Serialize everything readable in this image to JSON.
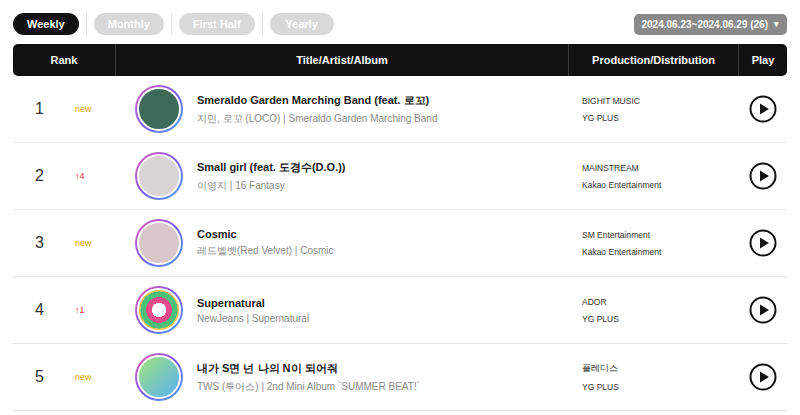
{
  "tabs": [
    {
      "label": "Weekly",
      "selected": true
    },
    {
      "label": "Monthly",
      "selected": false
    },
    {
      "label": "First Half",
      "selected": false
    },
    {
      "label": "Yearly",
      "selected": false
    }
  ],
  "period": {
    "label": "2024.06.23~2024.06.29 (26)",
    "icon": "▾"
  },
  "table": {
    "columns": [
      "Rank",
      "Title/Artist/Album",
      "Production/Distribution",
      "Play"
    ],
    "rows": [
      {
        "rank": "1",
        "change": "new",
        "change_kind": "new",
        "title": "Smeraldo Garden Marching Band (feat. 로꼬)",
        "meta": "지민, 로꼬 (LOCO) | Smeraldo Garden Marching Band",
        "production": "BIGHIT MUSIC",
        "distribution": "YG PLUS"
      },
      {
        "rank": "2",
        "change": "↑4",
        "change_kind": "up",
        "title": "Small girl (feat. 도경수(D.O.))",
        "meta": "이영지 | 16 Fantasy",
        "production": "MAINSTREAM",
        "distribution": "Kakao Entertainment"
      },
      {
        "rank": "3",
        "change": "new",
        "change_kind": "new",
        "title": "Cosmic",
        "meta": "레드벨벳(Red Velvet) | Cosmic",
        "production": "SM Entertainment",
        "distribution": "Kakao Entertainment"
      },
      {
        "rank": "4",
        "change": "↑1",
        "change_kind": "up",
        "title": "Supernatural",
        "meta": "NewJeans | Supernatural",
        "production": "ADOR",
        "distribution": "YG PLUS"
      },
      {
        "rank": "5",
        "change": "new",
        "change_kind": "new",
        "title": "내가 S면 넌 나의 N이 되어줘",
        "meta": "TWS (투어스) | 2nd Mini Album `SUMMER BEAT!`",
        "production": "플레디스",
        "distribution": "YG PLUS"
      }
    ]
  }
}
